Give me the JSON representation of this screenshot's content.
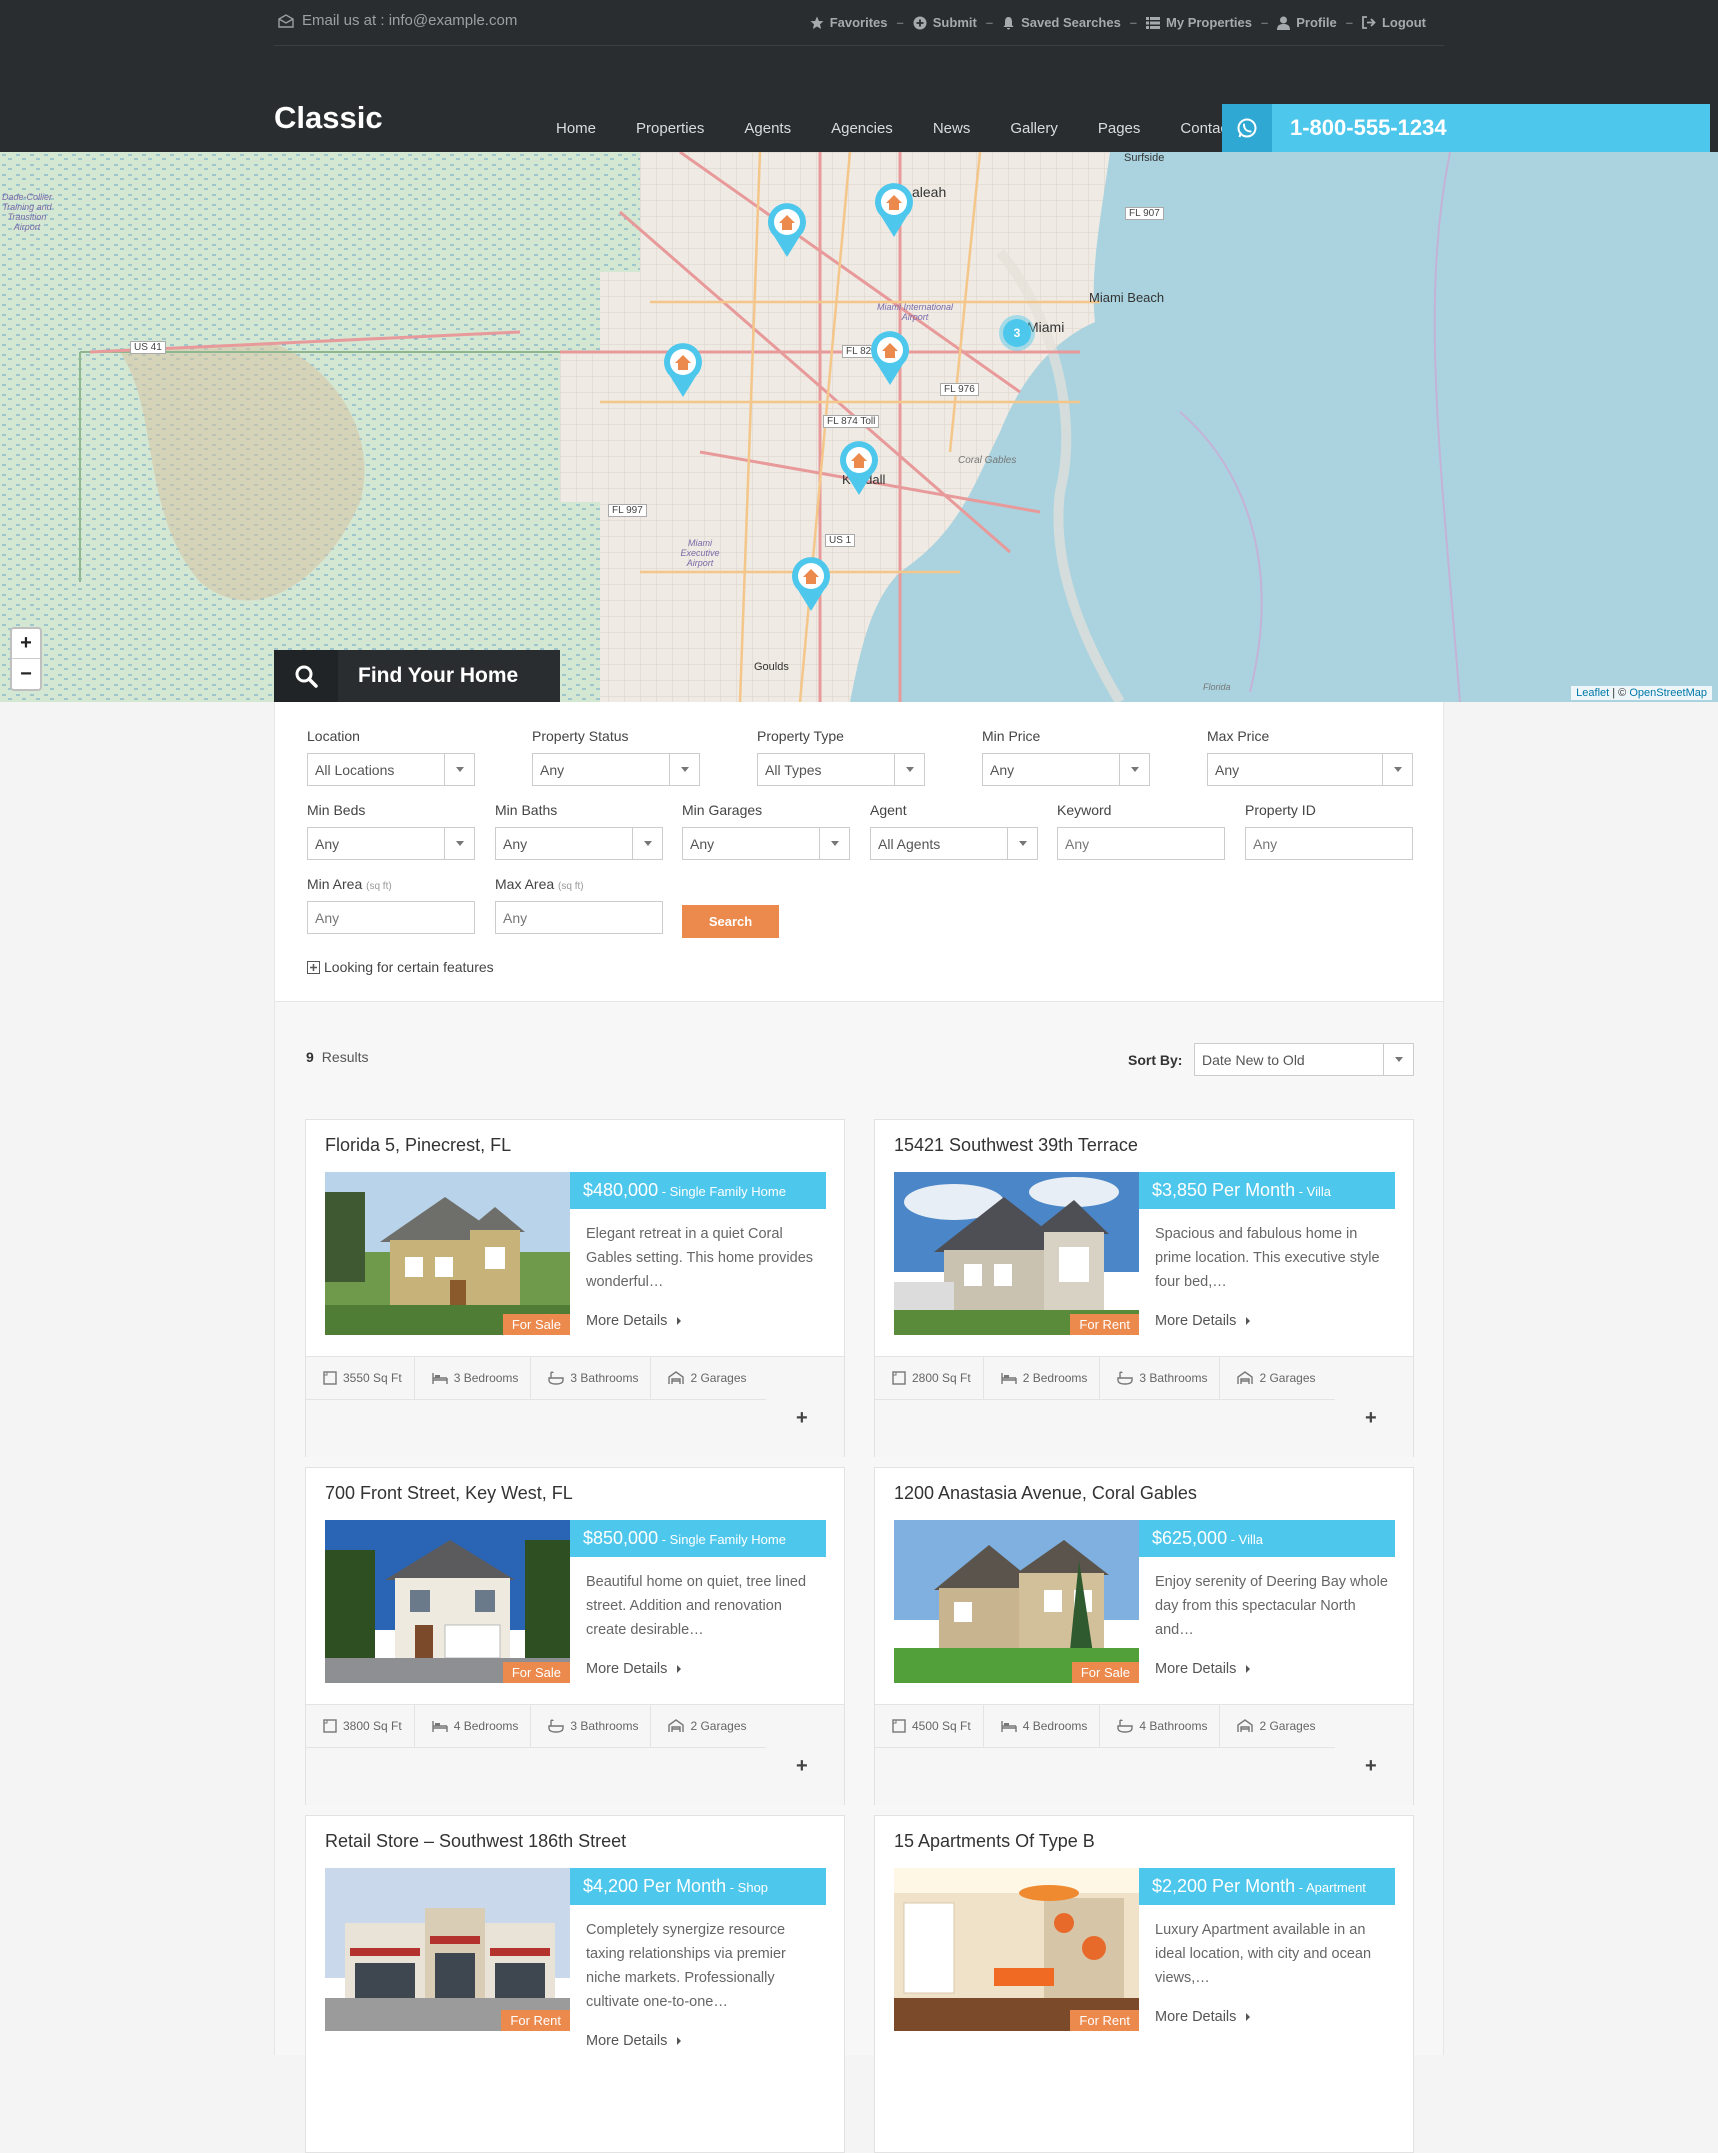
{
  "topbar": {
    "email": "Email us at : info@example.com",
    "menu": [
      {
        "label": "Favorites",
        "icon": "star-icon"
      },
      {
        "label": "Submit",
        "icon": "plus-circle-icon"
      },
      {
        "label": "Saved Searches",
        "icon": "bell-icon"
      },
      {
        "label": "My Properties",
        "icon": "list-icon"
      },
      {
        "label": "Profile",
        "icon": "user-icon"
      },
      {
        "label": "Logout",
        "icon": "logout-icon"
      }
    ]
  },
  "header": {
    "logo": "Classic",
    "nav": [
      "Home",
      "Properties",
      "Agents",
      "Agencies",
      "News",
      "Gallery",
      "Pages",
      "Contact"
    ],
    "phone": "1-800-555-1234"
  },
  "map": {
    "labels": [
      "Surfside",
      "Miami Beach",
      "Miami",
      "aleah",
      "FL 907",
      "US 41",
      "FL 82",
      "FL 976",
      "FL 874 Toll",
      "FL 997",
      "US 1",
      "Coral Gables",
      "Miami International Airport",
      "Miami Executive Airport",
      "Goulds",
      "Kendall",
      "Dade-Collier Training and Transition Airport",
      "Florida"
    ],
    "cluster_count": "3",
    "zoom_in": "+",
    "zoom_out": "−",
    "attribution_leaflet": "Leaflet",
    "attribution_sep": " | © ",
    "attribution_osm": "OpenStreetMap",
    "find_title": "Find Your Home"
  },
  "search": {
    "location": {
      "label": "Location",
      "value": "All Locations"
    },
    "status": {
      "label": "Property Status",
      "value": "Any"
    },
    "type": {
      "label": "Property Type",
      "value": "All Types"
    },
    "min_price": {
      "label": "Min Price",
      "value": "Any"
    },
    "max_price": {
      "label": "Max Price",
      "value": "Any"
    },
    "min_beds": {
      "label": "Min Beds",
      "value": "Any"
    },
    "min_baths": {
      "label": "Min Baths",
      "value": "Any"
    },
    "min_garages": {
      "label": "Min Garages",
      "value": "Any"
    },
    "agent": {
      "label": "Agent",
      "value": "All Agents"
    },
    "keyword": {
      "label": "Keyword",
      "placeholder": "Any"
    },
    "property_id": {
      "label": "Property ID",
      "placeholder": "Any"
    },
    "min_area": {
      "label": "Min Area",
      "unit": "(sq ft)",
      "placeholder": "Any"
    },
    "max_area": {
      "label": "Max Area",
      "unit": "(sq ft)",
      "placeholder": "Any"
    },
    "button": "Search",
    "features_link": "Looking for certain features"
  },
  "results": {
    "count": "9",
    "count_label": "Results",
    "sort_label": "Sort By:",
    "sort_value": "Date New to Old",
    "more_label": "More Details",
    "cards": [
      {
        "title": "Florida 5, Pinecrest, FL",
        "price": "$480,000",
        "ptype": " - Single Family Home",
        "status": "For Sale",
        "desc": "Elegant retreat in a quiet Coral Gables setting. This home provides wonderful…",
        "area": "3550 Sq Ft",
        "beds": "3 Bedrooms",
        "baths": "3 Bathrooms",
        "garages": "2 Garages"
      },
      {
        "title": "15421 Southwest 39th Terrace",
        "price": "$3,850 Per Month",
        "ptype": " - Villa",
        "status": "For Rent",
        "desc": "Spacious and fabulous home in prime location. This executive style four bed,…",
        "area": "2800 Sq Ft",
        "beds": "2 Bedrooms",
        "baths": "3 Bathrooms",
        "garages": "2 Garages"
      },
      {
        "title": "700 Front Street, Key West, FL",
        "price": "$850,000",
        "ptype": " - Single Family Home",
        "status": "For Sale",
        "desc": "Beautiful home on quiet, tree lined street. Addition and renovation create desirable…",
        "area": "3800 Sq Ft",
        "beds": "4 Bedrooms",
        "baths": "3 Bathrooms",
        "garages": "2 Garages"
      },
      {
        "title": "1200 Anastasia Avenue, Coral Gables",
        "price": "$625,000",
        "ptype": " - Villa",
        "status": "For Sale",
        "desc": "Enjoy serenity of Deering Bay whole day from this spectacular North and…",
        "area": "4500 Sq Ft",
        "beds": "4 Bedrooms",
        "baths": "4 Bathrooms",
        "garages": "2 Garages"
      },
      {
        "title": "Retail Store – Southwest 186th Street",
        "price": "$4,200 Per Month",
        "ptype": " - Shop",
        "status": "For Rent",
        "desc": "Completely synergize resource taxing relationships via premier niche markets. Professionally cultivate one-to-one…"
      },
      {
        "title": "15 Apartments Of Type B",
        "price": "$2,200 Per Month",
        "ptype": " - Apartment",
        "status": "For Rent",
        "desc": "Luxury Apartment available in an ideal location, with city and ocean views,…"
      }
    ]
  },
  "colors": {
    "accent": "#4dc7ec",
    "orange": "#ec894d",
    "header": "#2a2d2f"
  }
}
